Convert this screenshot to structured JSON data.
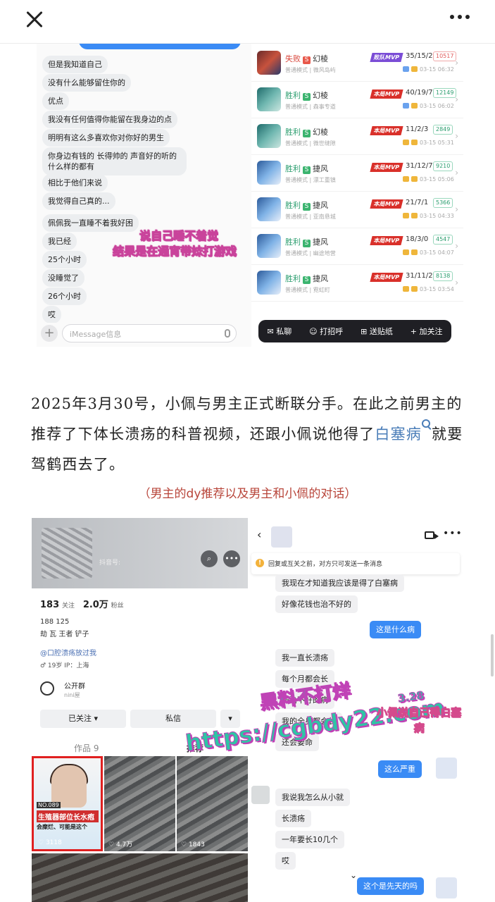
{
  "topbar": {
    "close_icon": "close-icon",
    "more_icon": "more-dots-icon"
  },
  "shot1": {
    "messages": [
      "但是我知道自己",
      "没有什么能够留住你的",
      "优点",
      "我没有任何值得你能留在我身边的点",
      "明明有这么多喜欢你对你好的男生",
      "你身边有钱的 长得帅的 声音好的听的什么样的都有",
      "相比于他们来说",
      "我觉得自己真的...",
      "佩佩我一直睡不着我好困",
      "我已经",
      "25个小时",
      "没睡觉了",
      "26个小时",
      "哎"
    ],
    "input_placeholder": "iMessage信息",
    "games": [
      {
        "status": "失败",
        "hero": "幻棱",
        "mode": "普通模式 | 微风岛屿",
        "mvp": "败队MVP",
        "kda": "35/15/2",
        "score": "10517",
        "time": "03-15 06:32",
        "avatar": "red"
      },
      {
        "status": "胜利",
        "hero": "幻棱",
        "mode": "普通模式 | 森事专道",
        "mvp": "本局MVP",
        "kda": "40/19/7",
        "score": "12149",
        "time": "03-15 06:02",
        "avatar": "teal"
      },
      {
        "status": "胜利",
        "hero": "幻棱",
        "mode": "普通模式 | 微世缝隙",
        "mvp": "本局MVP",
        "kda": "11/2/3",
        "score": "2849",
        "time": "03-15 05:31",
        "avatar": "teal"
      },
      {
        "status": "胜利",
        "hero": "捷风",
        "mode": "普通模式 | 漂工重镇",
        "mvp": "本局MVP",
        "kda": "31/12/7",
        "score": "9210",
        "time": "03-15 05:06",
        "avatar": "blue"
      },
      {
        "status": "胜利",
        "hero": "捷风",
        "mode": "普通模式 | 亚南悬城",
        "mvp": "本局MVP",
        "kda": "21/7/1",
        "score": "5366",
        "time": "03-15 04:33",
        "avatar": "blue"
      },
      {
        "status": "胜利",
        "hero": "捷风",
        "mode": "普通模式 | 幽途地营",
        "mvp": "本局MVP",
        "kda": "18/3/0",
        "score": "4547",
        "time": "03-15 04:07",
        "avatar": "blue"
      },
      {
        "status": "胜利",
        "hero": "捷风",
        "mode": "普通模式 | 霓虹町",
        "mvp": "本局MVP",
        "kda": "31/11/2",
        "score": "8138",
        "time": "03-15 03:54",
        "avatar": "blue"
      }
    ],
    "actions": [
      "私聊",
      "打招呼",
      "送贴纸",
      "加关注"
    ],
    "caption_line1": "说自己睡不着觉",
    "caption_line2": "结果是在通宵带妹打游戏"
  },
  "article": {
    "text_before": "2025年3月30号，小佩与男主正式断联分手。在此之前男主的推荐了下体长溃疡的科普视频，还跟小佩说他得了",
    "link": "白塞病",
    "text_after": "就要驾鹤西去了。",
    "caption": "（男主的dy推荐以及男主和小佩的对话）"
  },
  "profile": {
    "douyin_id": "抖音号:",
    "following": "183",
    "following_label": "关注",
    "fans": "2.0万",
    "fans_label": "粉丝",
    "line1": "188 125",
    "line2": "劫 瓦 王者 铲子",
    "link": "@口腔溃疡放过我",
    "meta": "♂ 19岁   IP：上海",
    "group_title": "公开群",
    "group_sub": "nini屋",
    "btn_followed": "已关注 ▾",
    "btn_msg": "私信",
    "btn_more": "▾",
    "tab_works": "作品 9",
    "tab_rec": "推荐",
    "video1_tag": "NO.089",
    "video1_title": "生殖器部位长水疱",
    "video1_sub": "会糜烂、可能是这个",
    "video1_likes": "3118",
    "video2_likes": "4.7万",
    "video3_likes": "1843"
  },
  "chat": {
    "notice": "回复或互关之前，对方只可发送一条消息",
    "messages": [
      {
        "dir": "in",
        "text": "我现在才知道我应该是得了白塞病"
      },
      {
        "dir": "in",
        "text": "好像花钱也治不好的"
      },
      {
        "dir": "out",
        "text": "这是什么病"
      },
      {
        "dir": "in",
        "text": "我一直长溃疡"
      },
      {
        "dir": "in",
        "text": "每个月都会长"
      },
      {
        "dir": "in",
        "text": "一治不好的病"
      },
      {
        "dir": "in",
        "text": "我的全身都会长"
      },
      {
        "dir": "in",
        "text": "还会要命"
      },
      {
        "dir": "out",
        "text": "这么严重"
      },
      {
        "dir": "in",
        "text": "我说我怎么从小就"
      },
      {
        "dir": "in",
        "text": "长溃疡"
      },
      {
        "dir": "in",
        "text": "一年要长10几个"
      },
      {
        "dir": "in",
        "text": "哎"
      },
      {
        "dir": "out",
        "text": "这个是先天的吗"
      }
    ],
    "date_note": "3.28",
    "red_caption": "小佩说自己得白塞病"
  },
  "watermark": {
    "line1": "黑料不打烊",
    "line2": "https://cgbdy22.com"
  }
}
